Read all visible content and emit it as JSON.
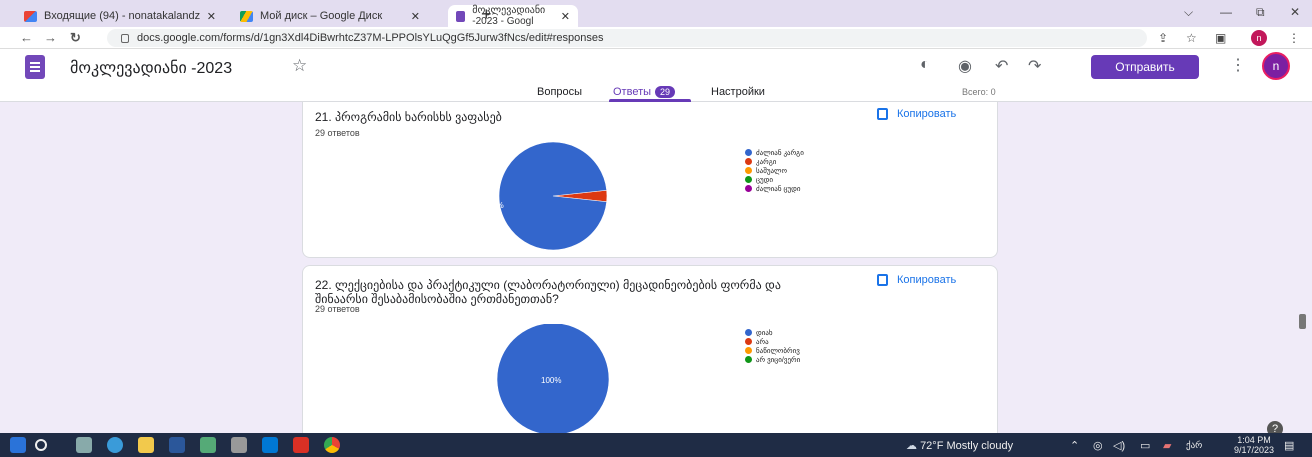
{
  "browser": {
    "tabs": [
      {
        "label": "Входящие (94) - nonatakalandz",
        "close": "✕"
      },
      {
        "label": "Мой диск – Google Диск",
        "close": "✕"
      },
      {
        "label": "მოკლევადიანი -2023 - Googl",
        "close": "✕"
      }
    ],
    "new_tab": "+",
    "url": "docs.google.com/forms/d/1gn3Xdl4DiBwrhtcZ37M-LPPOlsYLuQgGf5Jurw3fNcs/edit#responses",
    "window_controls": {
      "minimize": "—",
      "restore": "⧉",
      "close": "✕",
      "collapse": "⌵"
    }
  },
  "form": {
    "title": "მოკლევადიანი -2023",
    "send_label": "Отправить",
    "avatar_letter": "n",
    "tabs": {
      "questions": "Вопросы",
      "responses": "Ответы",
      "responses_count": "29",
      "settings": "Настройки"
    },
    "total": "Всего: 0"
  },
  "cards": [
    {
      "title": "21. პროგრამის ხარისხს ვაფასებ",
      "responses": "29 ответов",
      "copy": "Копировать",
      "chart_data": {
        "type": "pie",
        "labels": [
          "ძალიან კარგი",
          "კარგი",
          "საშუალო",
          "ცუდი",
          "ძალიან ცუდი"
        ],
        "colors": [
          "#3366cc",
          "#dc3912",
          "#ff9900",
          "#109618",
          "#990099"
        ],
        "values": [
          96.6,
          3.4,
          0,
          0,
          0
        ],
        "slice_label": "96,6%"
      }
    },
    {
      "title": "22. ლექციებისა და პრაქტიკული (ლაბორატორიული) მეცადინეობების ფორმა და შინაარსი შესაბამისობაშია ერთმანეთთან?",
      "responses": "29 ответов",
      "copy": "Копировать",
      "chart_data": {
        "type": "pie",
        "labels": [
          "დიახ",
          "არა",
          "ნაწილობრივ",
          "არ ვიცი/ვერი"
        ],
        "colors": [
          "#3366cc",
          "#dc3912",
          "#ff9900",
          "#109618"
        ],
        "values": [
          100,
          0,
          0,
          0
        ],
        "slice_label": "100%"
      }
    }
  ],
  "taskbar": {
    "weather": "72°F  Mostly cloudy",
    "lang": "ქარ",
    "time": "1:04 PM",
    "date": "9/17/2023"
  },
  "help_label": "?"
}
